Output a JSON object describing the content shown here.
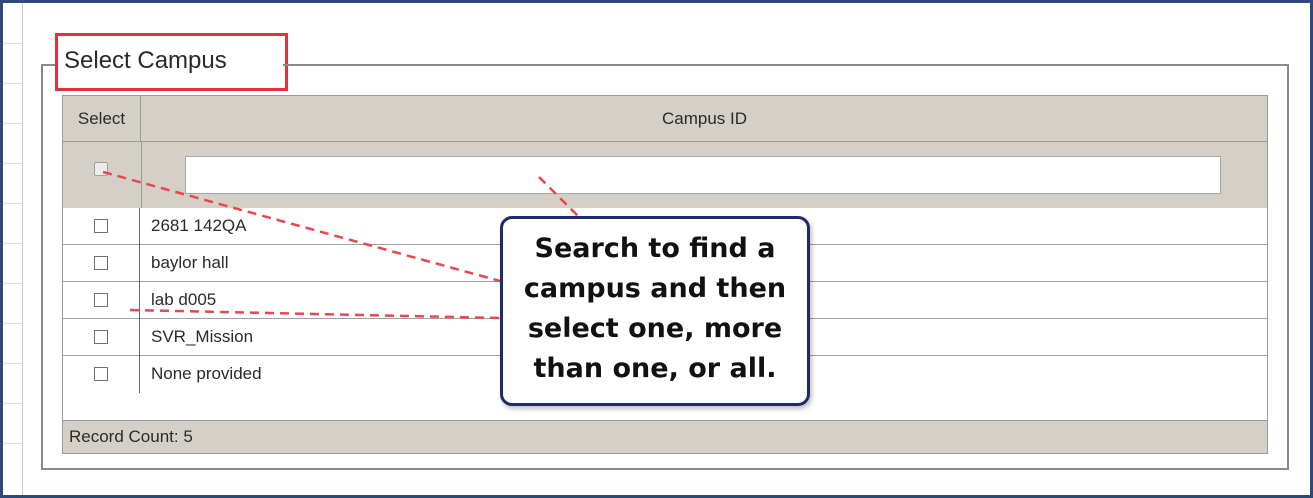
{
  "fieldset": {
    "legend": "Select Campus"
  },
  "grid": {
    "columns": [
      "Select",
      "Campus ID"
    ],
    "filter_value": "",
    "rows": [
      {
        "campus_id": "2681 142QA"
      },
      {
        "campus_id": "baylor hall"
      },
      {
        "campus_id": "lab d005"
      },
      {
        "campus_id": "SVR_Mission"
      },
      {
        "campus_id": "None provided"
      }
    ],
    "record_count": "Record Count: 5"
  },
  "callout": {
    "lines": [
      "Search to find a",
      "campus and then",
      "select one, more",
      "than one, or all."
    ]
  },
  "colors": {
    "highlight_box": "#e0333b",
    "callout_border": "#1f2a6b",
    "callout_lines": "#e8474e",
    "grid_header_bg": "#d4d0c8",
    "frame_border": "#2f4a7a"
  }
}
